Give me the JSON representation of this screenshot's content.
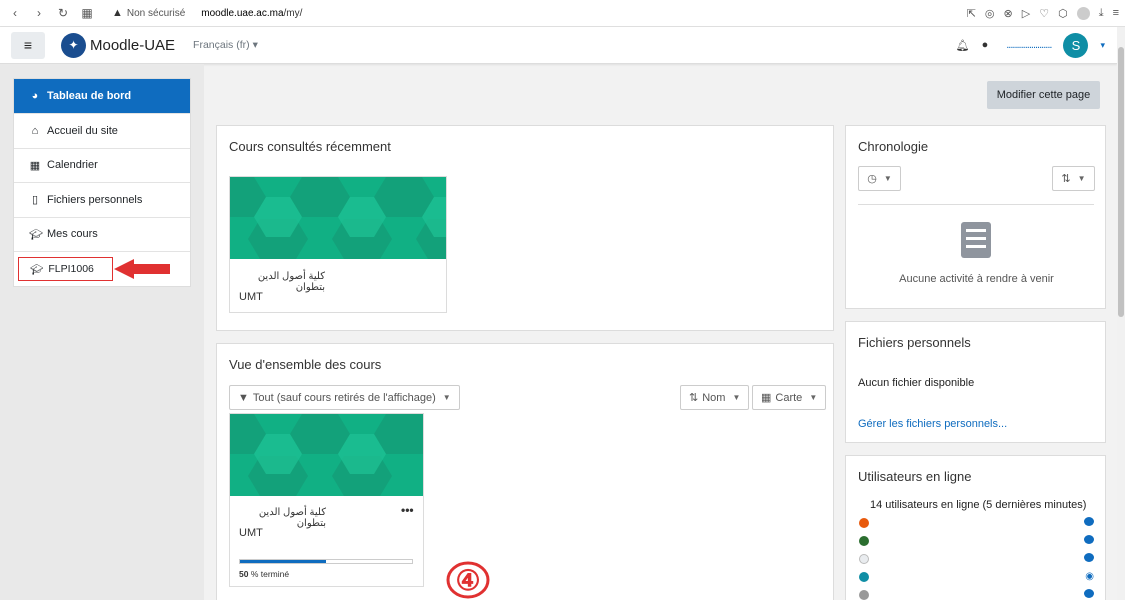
{
  "browser": {
    "security": "Non sécurisé",
    "url_host": "moodle.uae.ac.ma",
    "url_path": "/my/"
  },
  "navbar": {
    "brand": "Moodle-UAE",
    "language": "Français (fr)",
    "username_dots": "......................",
    "avatar_initial": "S"
  },
  "sidebar": {
    "items": [
      {
        "label": "Tableau de bord",
        "icon": "dashboard-icon"
      },
      {
        "label": "Accueil du site",
        "icon": "home-icon"
      },
      {
        "label": "Calendrier",
        "icon": "calendar-icon"
      },
      {
        "label": "Fichiers personnels",
        "icon": "file-icon"
      },
      {
        "label": "Mes cours",
        "icon": "graduation-cap-icon"
      }
    ],
    "course": {
      "label": "FLPI1006",
      "icon": "graduation-cap-icon"
    }
  },
  "main": {
    "edit_button": "Modifier cette page",
    "recent": {
      "title": "Cours consultés récemment",
      "course": {
        "name_ar": "كلية أصول الدين بتطوان",
        "short": "UMT"
      }
    },
    "overview": {
      "title": "Vue d'ensemble des cours",
      "filter": "Tout (sauf cours retirés de l'affichage)",
      "sort": "Nom",
      "view": "Carte",
      "course": {
        "name_ar": "كلية أصول الدين بتطوان",
        "short": "UMT",
        "menu": "•••",
        "progress": 50,
        "progress_value": "50",
        "progress_suffix": " % terminé"
      }
    }
  },
  "annotation": "④",
  "blocks": {
    "chrono": {
      "title": "Chronologie",
      "empty": "Aucune activité à rendre à venir"
    },
    "files": {
      "title": "Fichiers personnels",
      "empty": "Aucun fichier disponible",
      "manage": "Gérer les fichiers personnels..."
    },
    "online": {
      "title": "Utilisateurs en ligne",
      "summary": "14 utilisateurs en ligne (5 dernières minutes)",
      "users": [
        {
          "color": "#e8590c",
          "initial": "6",
          "action": "message"
        },
        {
          "color": "#2b6e2f",
          "initial": "A",
          "action": "message"
        },
        {
          "color": "#e9ecef",
          "initial": "",
          "action": "message"
        },
        {
          "color": "#0f8ea5",
          "initial": "6",
          "action": "view"
        }
      ]
    }
  },
  "colors": {
    "accent": "#0f6cbf",
    "arrow": "#e03131",
    "hex_green": "#11b084"
  }
}
